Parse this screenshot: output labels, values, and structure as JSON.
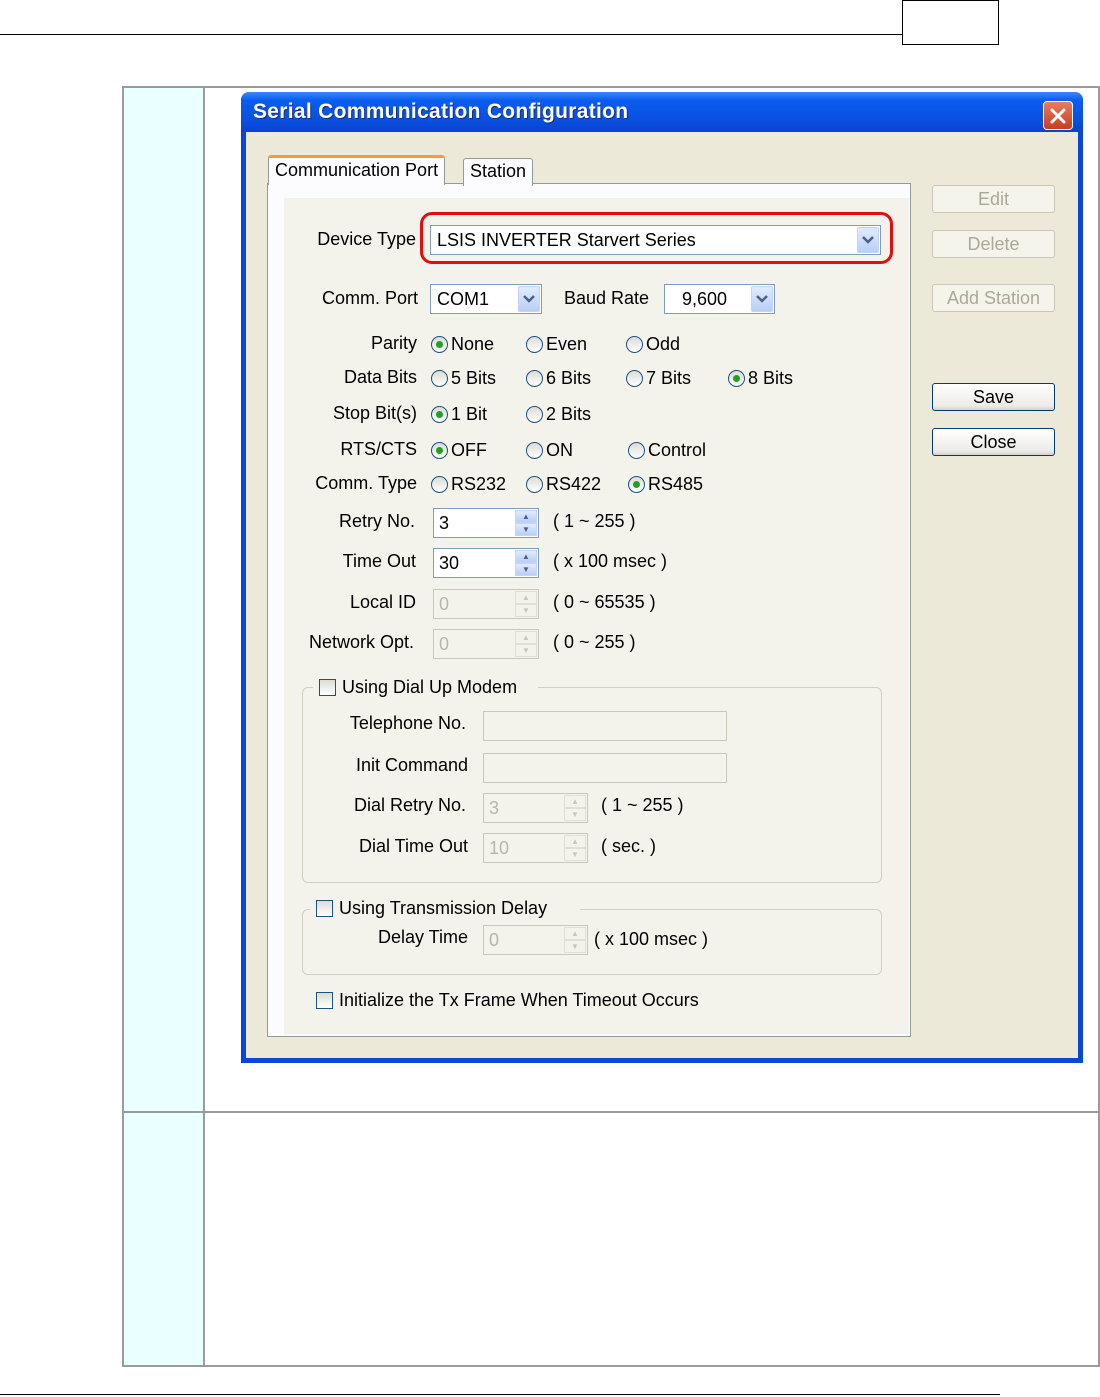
{
  "window": {
    "title": "Serial Communication Configuration",
    "close_icon": "close-icon"
  },
  "tabs": [
    {
      "label": "Communication Port",
      "active": true
    },
    {
      "label": "Station",
      "active": false
    }
  ],
  "device_type": {
    "label": "Device Type",
    "value": "LSIS INVERTER Starvert Series"
  },
  "comm_port": {
    "label": "Comm. Port",
    "value": "COM1"
  },
  "baud_rate": {
    "label": "Baud Rate",
    "value": "9,600"
  },
  "parity": {
    "label": "Parity",
    "options": [
      "None",
      "Even",
      "Odd"
    ],
    "selected": "None"
  },
  "data_bits": {
    "label": "Data Bits",
    "options": [
      "5 Bits",
      "6 Bits",
      "7 Bits",
      "8 Bits"
    ],
    "selected": "8 Bits"
  },
  "stop_bits": {
    "label": "Stop Bit(s)",
    "options": [
      "1 Bit",
      "2 Bits"
    ],
    "selected": "1 Bit"
  },
  "rts_cts": {
    "label": "RTS/CTS",
    "options": [
      "OFF",
      "ON",
      "Control"
    ],
    "selected": "OFF"
  },
  "comm_type": {
    "label": "Comm. Type",
    "options": [
      "RS232",
      "RS422",
      "RS485"
    ],
    "selected": "RS485"
  },
  "retry_no": {
    "label": "Retry No.",
    "value": "3",
    "range": "( 1 ~ 255 )"
  },
  "time_out": {
    "label": "Time Out",
    "value": "30",
    "range": "( x 100 msec )"
  },
  "local_id": {
    "label": "Local ID",
    "value": "0",
    "range": "( 0 ~ 65535 )"
  },
  "network_opt": {
    "label": "Network Opt.",
    "value": "0",
    "range": "( 0 ~ 255 )"
  },
  "dial_modem": {
    "label": "Using Dial Up Modem",
    "telephone_label": "Telephone No.",
    "init_label": "Init Command",
    "dial_retry_label": "Dial Retry No.",
    "dial_retry_value": "3",
    "dial_retry_range": "( 1 ~ 255 )",
    "dial_timeout_label": "Dial Time Out",
    "dial_timeout_value": "10",
    "dial_timeout_range": "( sec. )"
  },
  "tx_delay": {
    "label": "Using Transmission Delay",
    "delay_label": "Delay Time",
    "delay_value": "0",
    "delay_range": "( x 100 msec )"
  },
  "init_tx": {
    "label": "Initialize the Tx Frame When Timeout  Occurs"
  },
  "buttons": {
    "edit": "Edit",
    "delete": "Delete",
    "add_station": "Add Station",
    "save": "Save",
    "close": "Close"
  }
}
